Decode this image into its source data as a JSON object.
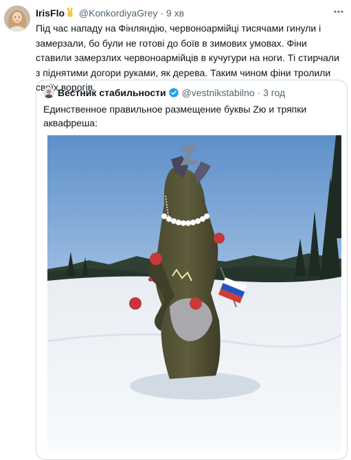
{
  "tweet": {
    "author_name": "IrisFlo",
    "author_emoji": "✌",
    "author_handle": "@KonkordiyaGrey",
    "separator": "·",
    "time": "9 хв",
    "more_icon": "more-dots-icon",
    "text": "Під час нападу на Фінляндію, червоноармійці тисячами гинули і замерзали, бо були не готові до боїв в зимових умовах. Фіни ставили замерзлих червоноармійців в кучугури на ноги. Ті стирчали з піднятими догори руками, як дерева. Таким чином фіни тролили своїх ворогів."
  },
  "quoted": {
    "author_name": "Вестник стабильности",
    "verified_icon": "verified-badge-icon",
    "author_handle": "@vestnikstabilno",
    "separator": "·",
    "time": "3 год",
    "text": "Единственное правильное размещение буквы Zю и тряпки аквафреша:",
    "photo_icon": "z-letter-christmas-scarecrow-photo",
    "colors": {
      "link_blue": "#1d9bf0",
      "muted": "#536471",
      "border": "#cfd9de"
    }
  }
}
